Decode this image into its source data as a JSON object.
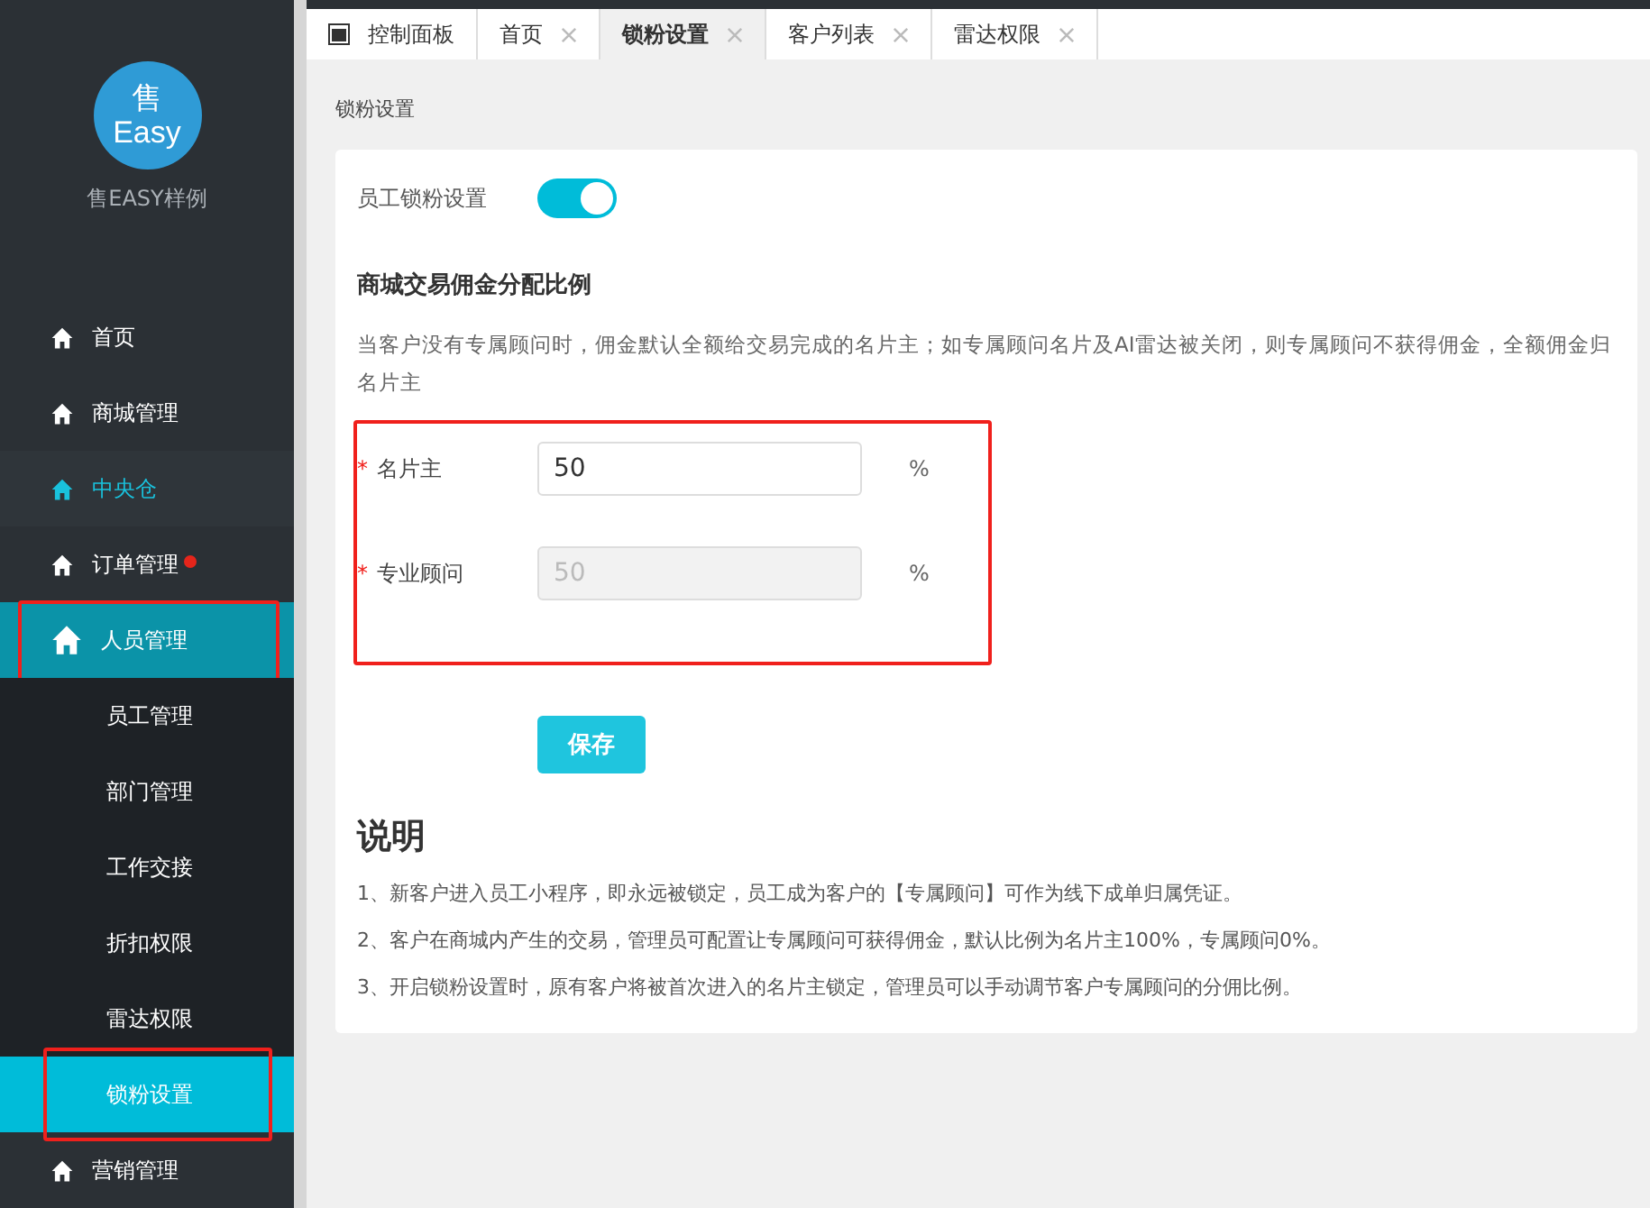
{
  "sidebar": {
    "logo_text": "售\nEasy",
    "brand": "售EASY样例",
    "items": [
      {
        "label": "首页",
        "selected": false,
        "badge": false,
        "highlighted": false
      },
      {
        "label": "商城管理",
        "selected": false,
        "badge": false,
        "highlighted": false
      },
      {
        "label": "中央仓",
        "selected": true,
        "badge": false,
        "highlighted": false
      },
      {
        "label": "订单管理",
        "selected": false,
        "badge": true,
        "highlighted": false
      },
      {
        "label": "人员管理",
        "selected": false,
        "badge": false,
        "highlighted": true,
        "expanded": true,
        "children": [
          {
            "label": "员工管理",
            "selected": false,
            "highlighted": false
          },
          {
            "label": "部门管理",
            "selected": false,
            "highlighted": false
          },
          {
            "label": "工作交接",
            "selected": false,
            "highlighted": false
          },
          {
            "label": "折扣权限",
            "selected": false,
            "highlighted": false
          },
          {
            "label": "雷达权限",
            "selected": false,
            "highlighted": false
          },
          {
            "label": "锁粉设置",
            "selected": true,
            "highlighted": true
          }
        ]
      },
      {
        "label": "营销管理",
        "selected": false,
        "badge": false,
        "highlighted": false
      }
    ]
  },
  "tabs": [
    {
      "label": "控制面板",
      "kind": "home",
      "selected": false
    },
    {
      "label": "首页",
      "kind": "closable",
      "selected": false
    },
    {
      "label": "锁粉设置",
      "kind": "closable",
      "selected": true
    },
    {
      "label": "客户列表",
      "kind": "closable",
      "selected": false
    },
    {
      "label": "雷达权限",
      "kind": "closable",
      "selected": false
    }
  ],
  "breadcrumb": "锁粉设置",
  "form": {
    "toggle_label": "员工锁粉设置",
    "toggle_on": true,
    "section_title": "商城交易佣金分配比例",
    "description": "当客户没有专属顾问时，佣金默认全额给交易完成的名片主；如专属顾问名片及AI雷达被关闭，则专属顾问不获得佣金，全额佣金归名片主",
    "ratio_highlighted": true,
    "fields": [
      {
        "required_mark": "*",
        "label": "名片主",
        "value": "50",
        "unit": "%",
        "disabled": false
      },
      {
        "required_mark": "*",
        "label": "专业顾问",
        "value": "50",
        "unit": "%",
        "disabled": true
      }
    ],
    "save_button": "保存"
  },
  "notes": {
    "title": "说明",
    "items": [
      "1、新客户进入员工小程序，即永远被锁定，员工成为客户的【专属顾问】可作为线下成单归属凭证。",
      "2、客户在商城内产生的交易，管理员可配置让专属顾问可获得佣金，默认比例为名片主100%，专属顾问0%。",
      "3、开启锁粉设置时，原有客户将被首次进入的名片主锁定，管理员可以手动调节客户专属顾问的分佣比例。"
    ]
  }
}
